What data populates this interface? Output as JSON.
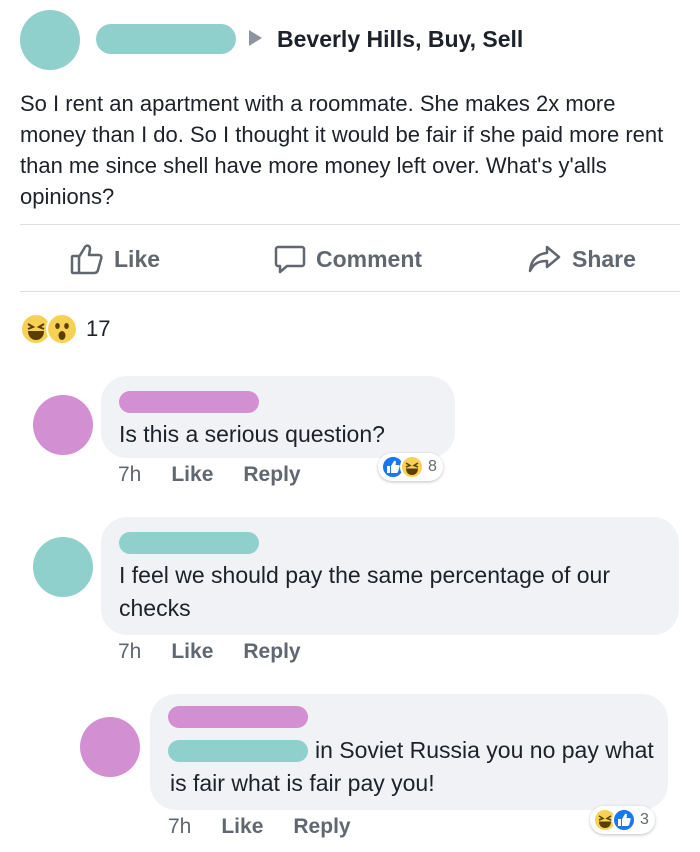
{
  "post": {
    "group_name": "Beverly Hills, Buy, Sell",
    "text": "So I rent an apartment with a roommate. She makes 2x more money than I do. So I thought it would be fair if she paid more rent than me since shell have more money left over. What's y'alls opinions?",
    "actions": {
      "like": "Like",
      "comment": "Comment",
      "share": "Share"
    },
    "reaction_count": "17",
    "reaction_icons": [
      "haha-emoji",
      "wow-emoji"
    ]
  },
  "comments": [
    {
      "text": "Is this a serious question?",
      "time": "7h",
      "like": "Like",
      "reply": "Reply",
      "reaction_count": "8",
      "avatar_color": "#d28fd1",
      "name_color": "#d28fd1"
    },
    {
      "text": "I feel we should pay the same percentage of our checks",
      "time": "7h",
      "like": "Like",
      "reply": "Reply",
      "avatar_color": "#8fd0cc",
      "name_color": "#8fd0cc"
    },
    {
      "text": "in Soviet Russia you no pay what is fair what is fair pay you!",
      "time": "7h",
      "like": "Like",
      "reply": "Reply",
      "reaction_count": "3",
      "avatar_color": "#d28fd1",
      "name_color": "#d28fd1",
      "mention_color": "#8fd0cc"
    }
  ],
  "colors": {
    "anonymized_teal": "#8fd0cc",
    "anonymized_pink": "#d28fd1",
    "like_blue": "#1877f2",
    "emoji_yellow": "#f7d154"
  }
}
